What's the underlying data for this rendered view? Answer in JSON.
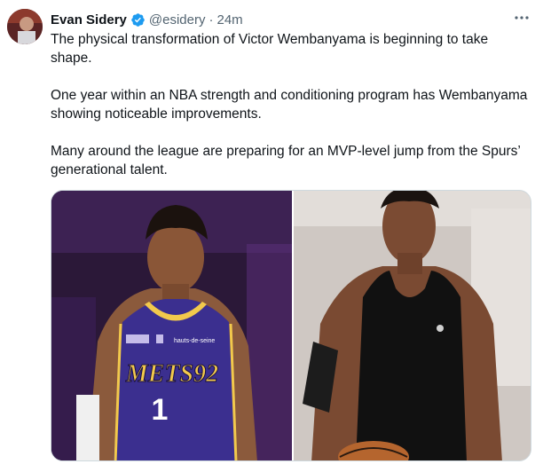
{
  "tweet": {
    "author_name": "Evan Sidery",
    "handle": "@esidery",
    "separator": "·",
    "time": "24m",
    "paragraphs": [
      "The physical transformation of Victor Wembanyama is beginning to take shape.",
      "One year within an NBA strength and conditioning program has Wembanyama showing noticeable improvements.",
      "Many around the league are preparing for an MVP-level jump from the Spurs’ generational talent."
    ],
    "media": [
      {
        "jersey_text": "METS92",
        "jersey_number": "1",
        "sponsor_text": "hauts-de-seine"
      },
      {
        "jersey_text": ""
      }
    ]
  },
  "colors": {
    "verified": "#1d9bf0",
    "secondary_text": "#536471",
    "jersey_purple": "#3b2f8f",
    "jersey_gold": "#f2c94c"
  },
  "icons": {
    "verified": "verified-badge-icon",
    "more": "more-horizontal-icon"
  }
}
